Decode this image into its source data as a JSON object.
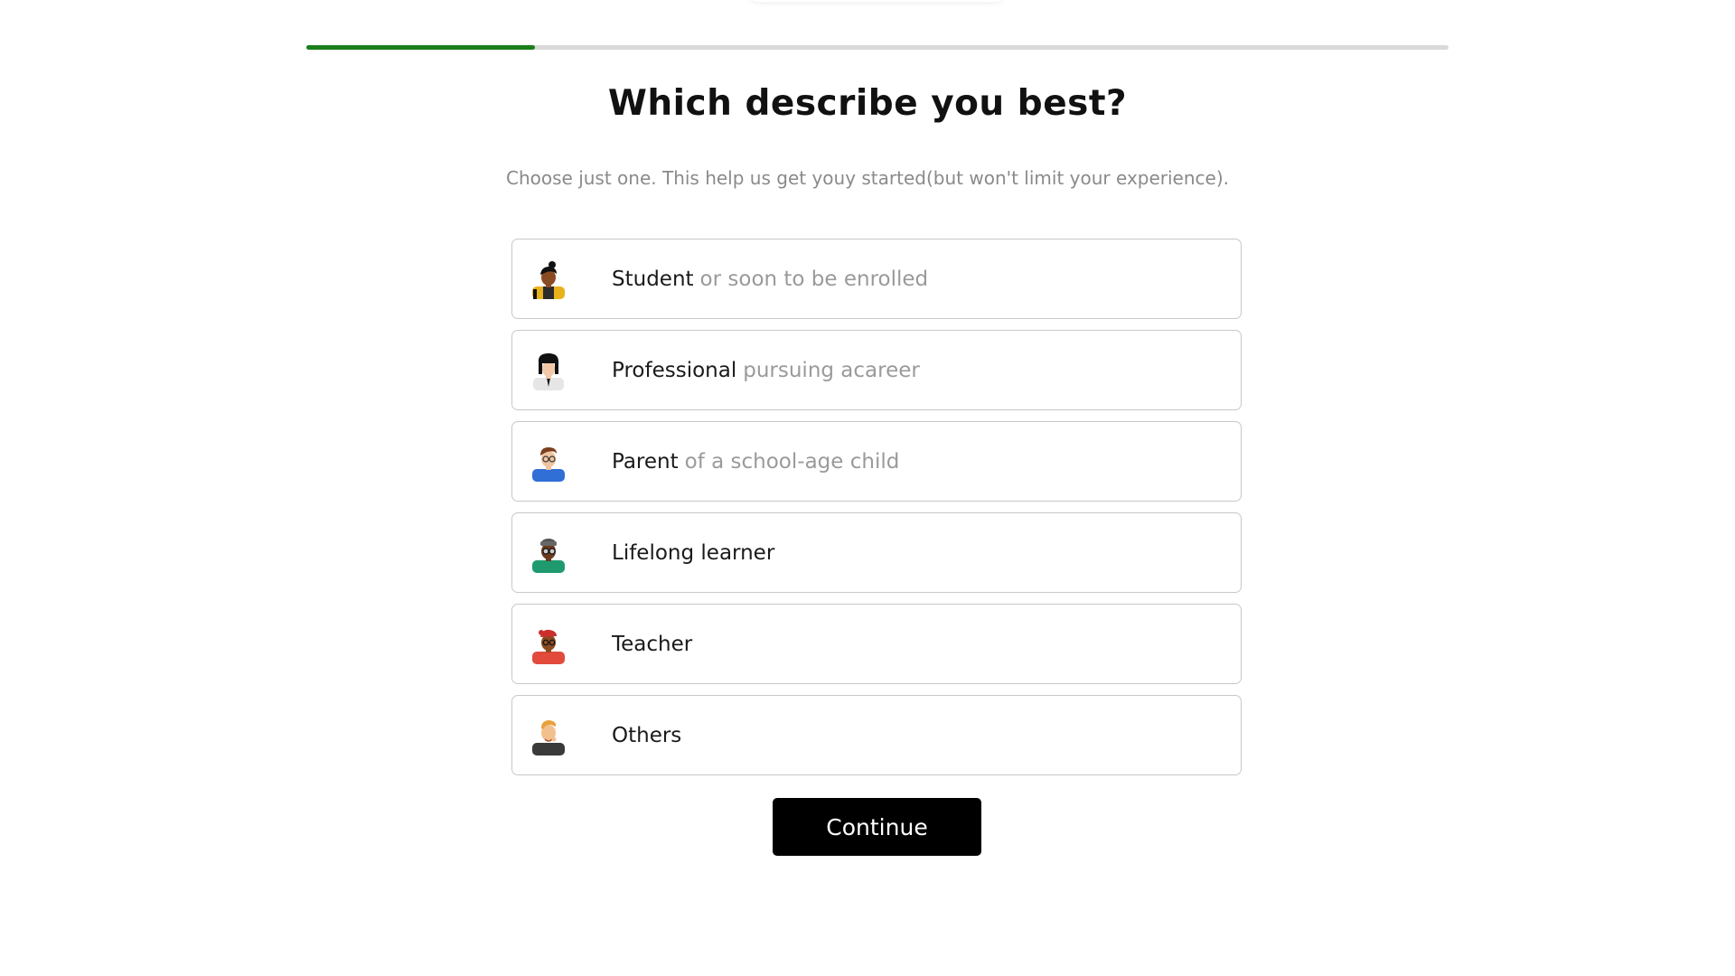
{
  "progress": {
    "percent": 20,
    "fill_color": "#1a7f1a",
    "track_color": "#d9d9d9"
  },
  "header": {
    "title": "Which describe you best?",
    "subtitle": "Choose just one. This help us get youy started(but won't limit your experience)."
  },
  "options": [
    {
      "label": "Student",
      "sub": "or soon to be enrolled",
      "icon": "student-avatar-icon"
    },
    {
      "label": "Professional",
      "sub": "pursuing acareer",
      "icon": "professional-avatar-icon"
    },
    {
      "label": "Parent",
      "sub": "of a school-age child",
      "icon": "parent-avatar-icon"
    },
    {
      "label": "Lifelong learner",
      "sub": "",
      "icon": "lifelong-learner-avatar-icon"
    },
    {
      "label": "Teacher",
      "sub": "",
      "icon": "teacher-avatar-icon"
    },
    {
      "label": "Others",
      "sub": "",
      "icon": "others-avatar-icon"
    }
  ],
  "continue_label": "Continue"
}
